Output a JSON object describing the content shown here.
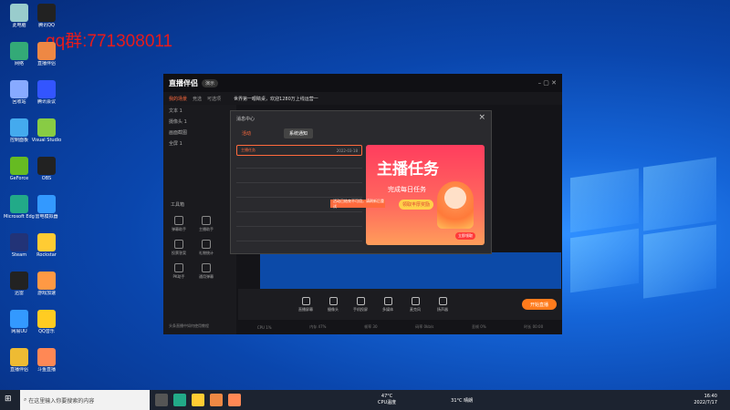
{
  "watermark": "qq群:771308011",
  "desktop_icons": [
    {
      "label": "此电脑",
      "color": "#9cc"
    },
    {
      "label": "腾讯QQ",
      "color": "#222"
    },
    {
      "label": "网络",
      "color": "#3a7"
    },
    {
      "label": "直播伴侣",
      "color": "#e84"
    },
    {
      "label": "回收站",
      "color": "#8af"
    },
    {
      "label": "腾讯会议",
      "color": "#35f"
    },
    {
      "label": "控制面板",
      "color": "#4ae"
    },
    {
      "label": "Visual Studio",
      "color": "#8c4"
    },
    {
      "label": "GeForce",
      "color": "#6b2"
    },
    {
      "label": "OBS",
      "color": "#222"
    },
    {
      "label": "Microsoft Edge",
      "color": "#2a8"
    },
    {
      "label": "雷电模拟器",
      "color": "#39f"
    },
    {
      "label": "Steam",
      "color": "#237"
    },
    {
      "label": "Rockstar",
      "color": "#fc3"
    },
    {
      "label": "迅雷",
      "color": "#222"
    },
    {
      "label": "游戏加速",
      "color": "#f94"
    },
    {
      "label": "网易UU",
      "color": "#39f"
    },
    {
      "label": "QQ音乐",
      "color": "#fc2"
    },
    {
      "label": "直播伴侣",
      "color": "#eb3"
    },
    {
      "label": "斗鱼直播",
      "color": "#f85"
    }
  ],
  "app": {
    "title": "直播伴侣",
    "version_badge": "演示",
    "notice": "世界第一眼睛桌，欢迎1280万上线运营一",
    "tabs": [
      "我的场景",
      "竞选",
      "可选项"
    ],
    "scenes": [
      "文本 1",
      "摄像头 1",
      "画面截图",
      "全屏 1"
    ],
    "toolbox_title": "工具箱",
    "tools": [
      "弹幕助手",
      "主播助手",
      "投票答案",
      "礼物统计",
      "PK助手",
      "通用弹幕",
      "更多功能",
      "摄像头管理"
    ],
    "controls": [
      "直播屏幕",
      "摄像头",
      "手机投屏",
      "多媒体",
      "麦克风",
      "扬声器"
    ],
    "start_label": "开始直播",
    "status": [
      "CPU 1%",
      "内存 47%",
      "帧率 30",
      "码率 0kb/s",
      "丢帧 0%",
      "时长 00:00"
    ],
    "footer_tip": "头条直播中如何使用教程"
  },
  "dialog": {
    "title": "消息中心",
    "tabs": [
      "活动",
      "系统通知"
    ],
    "item_title": "主播任务",
    "item_date": "2022-03-18",
    "toast": "活动已结束不可用，请刷新后重试",
    "promo_title": "主播任务",
    "promo_sub": "完成每日任务",
    "promo_btn": "领取丰厚奖励",
    "promo_action": "立即领取"
  },
  "taskbar": {
    "search_placeholder": "在这里输入你要搜索的内容",
    "weather": "31°C 晴朗",
    "temp": "47°C",
    "temp_label": "CPU温度",
    "time": "16:40",
    "date": "2022/7/17"
  }
}
